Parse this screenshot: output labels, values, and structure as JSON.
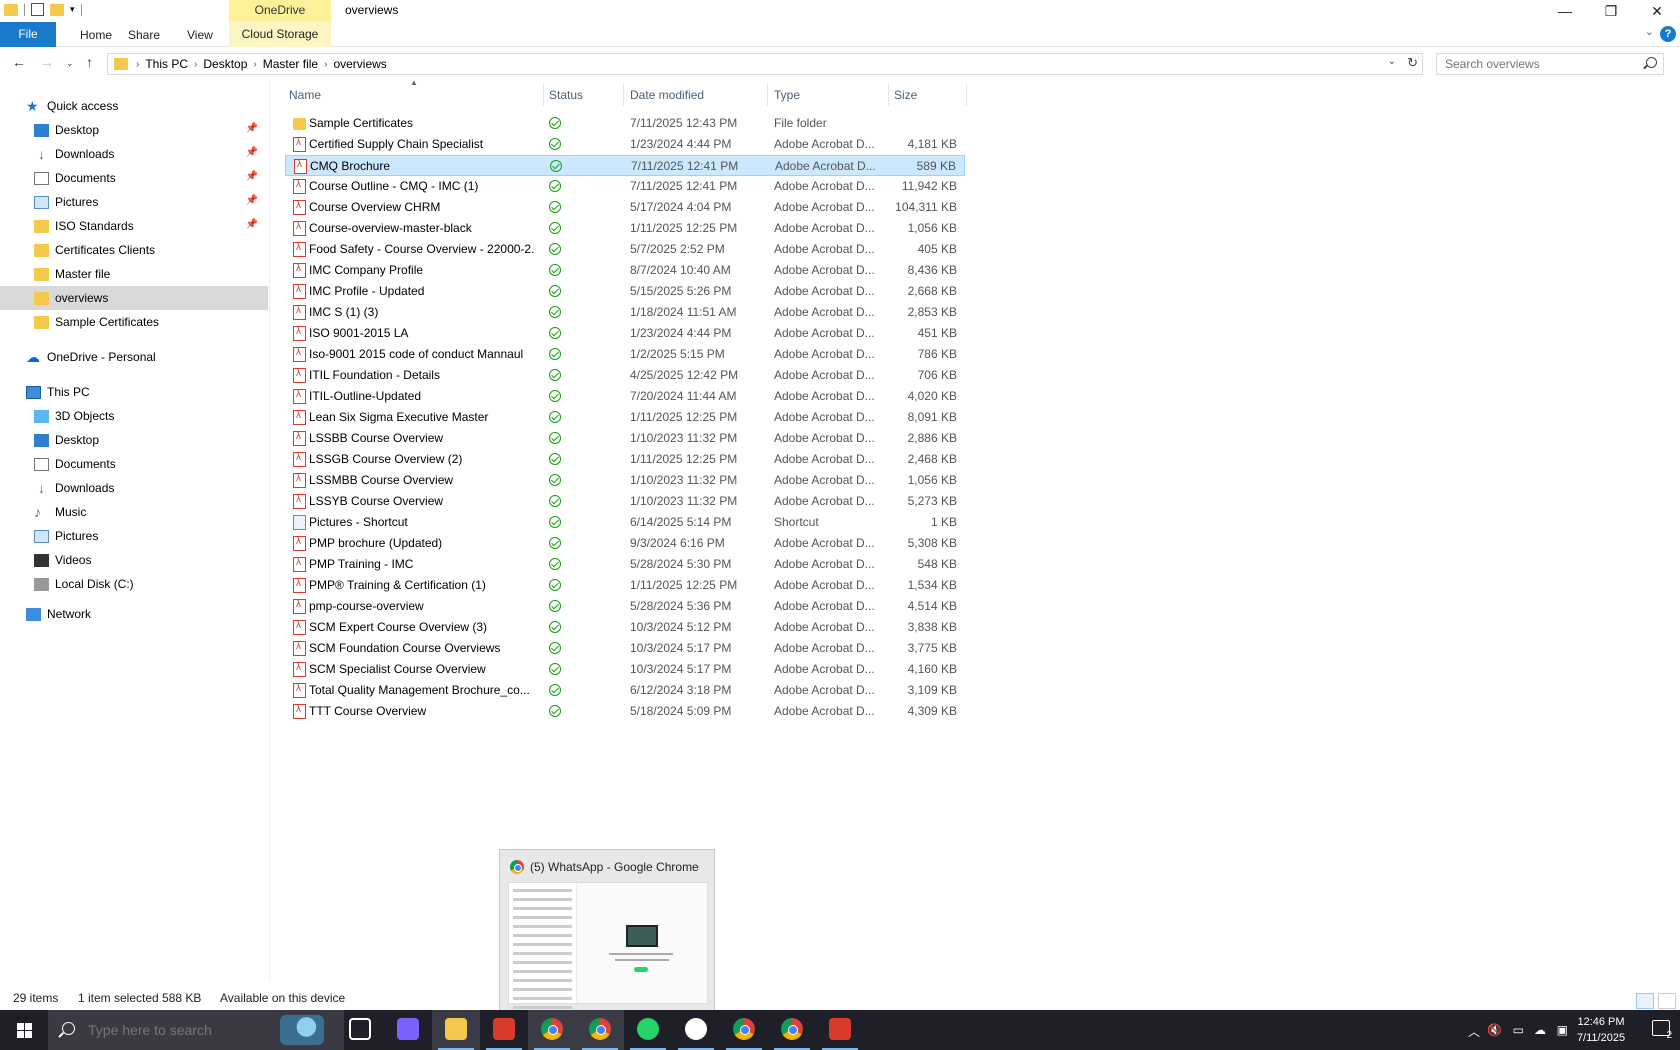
{
  "window": {
    "title": "overviews",
    "context_tab": "OneDrive",
    "controls": [
      "—",
      "❐",
      "✕"
    ]
  },
  "ribbon": {
    "file": "File",
    "home": "Home",
    "share": "Share",
    "view": "View",
    "cloud_storage": "Cloud Storage",
    "help": "?"
  },
  "address": {
    "crumbs": [
      "This PC",
      "Desktop",
      "Master file",
      "overviews"
    ],
    "search_placeholder": "Search overviews"
  },
  "nav": {
    "quick_access": "Quick access",
    "items": [
      {
        "label": "Desktop",
        "pinned": true
      },
      {
        "label": "Downloads",
        "pinned": true
      },
      {
        "label": "Documents",
        "pinned": true
      },
      {
        "label": "Pictures",
        "pinned": true
      },
      {
        "label": "ISO Standards",
        "pinned": true
      },
      {
        "label": "Certificates Clients",
        "pinned": false
      },
      {
        "label": "Master file",
        "pinned": false
      },
      {
        "label": "overviews",
        "pinned": false,
        "selected": true
      },
      {
        "label": "Sample Certificates",
        "pinned": false
      }
    ],
    "onedrive": "OneDrive - Personal",
    "this_pc": "This PC",
    "pc_items": [
      "3D Objects",
      "Desktop",
      "Documents",
      "Downloads",
      "Music",
      "Pictures",
      "Videos",
      "Local Disk (C:)"
    ],
    "network": "Network"
  },
  "columns": {
    "name": "Name",
    "status": "Status",
    "date": "Date modified",
    "type": "Type",
    "size": "Size"
  },
  "files": [
    {
      "name": "Sample Certificates",
      "date": "7/11/2025 12:43 PM",
      "type": "File folder",
      "size": "",
      "kind": "folder"
    },
    {
      "name": "Certified Supply Chain Specialist",
      "date": "1/23/2024 4:44 PM",
      "type": "Adobe Acrobat D...",
      "size": "4,181 KB",
      "kind": "pdf"
    },
    {
      "name": "CMQ Brochure",
      "date": "7/11/2025 12:41 PM",
      "type": "Adobe Acrobat D...",
      "size": "589 KB",
      "kind": "pdf",
      "selected": true
    },
    {
      "name": "Course Outline - CMQ - IMC (1)",
      "date": "7/11/2025 12:41 PM",
      "type": "Adobe Acrobat D...",
      "size": "11,942 KB",
      "kind": "pdf"
    },
    {
      "name": "Course Overview CHRM",
      "date": "5/17/2024 4:04 PM",
      "type": "Adobe Acrobat D...",
      "size": "104,311 KB",
      "kind": "pdf"
    },
    {
      "name": "Course-overview-master-black",
      "date": "1/11/2025 12:25 PM",
      "type": "Adobe Acrobat D...",
      "size": "1,056 KB",
      "kind": "pdf"
    },
    {
      "name": "Food Safety - Course Overview - 22000-2...",
      "date": "5/7/2025 2:52 PM",
      "type": "Adobe Acrobat D...",
      "size": "405 KB",
      "kind": "pdf"
    },
    {
      "name": "IMC Company Profile",
      "date": "8/7/2024 10:40 AM",
      "type": "Adobe Acrobat D...",
      "size": "8,436 KB",
      "kind": "pdf"
    },
    {
      "name": "IMC Profile - Updated",
      "date": "5/15/2025 5:26 PM",
      "type": "Adobe Acrobat D...",
      "size": "2,668 KB",
      "kind": "pdf"
    },
    {
      "name": "IMC S (1) (3)",
      "date": "1/18/2024 11:51 AM",
      "type": "Adobe Acrobat D...",
      "size": "2,853 KB",
      "kind": "pdf"
    },
    {
      "name": "ISO 9001-2015 LA",
      "date": "1/23/2024 4:44 PM",
      "type": "Adobe Acrobat D...",
      "size": "451 KB",
      "kind": "pdf"
    },
    {
      "name": "Iso-9001 2015 code of conduct Mannaul",
      "date": "1/2/2025 5:15 PM",
      "type": "Adobe Acrobat D...",
      "size": "786 KB",
      "kind": "pdf"
    },
    {
      "name": "ITIL Foundation - Details",
      "date": "4/25/2025 12:42 PM",
      "type": "Adobe Acrobat D...",
      "size": "706 KB",
      "kind": "pdf"
    },
    {
      "name": "ITIL-Outline-Updated",
      "date": "7/20/2024 11:44 AM",
      "type": "Adobe Acrobat D...",
      "size": "4,020 KB",
      "kind": "pdf"
    },
    {
      "name": "Lean Six Sigma Executive Master",
      "date": "1/11/2025 12:25 PM",
      "type": "Adobe Acrobat D...",
      "size": "8,091 KB",
      "kind": "pdf"
    },
    {
      "name": "LSSBB Course Overview",
      "date": "1/10/2023 11:32 PM",
      "type": "Adobe Acrobat D...",
      "size": "2,886 KB",
      "kind": "pdf"
    },
    {
      "name": "LSSGB Course Overview (2)",
      "date": "1/11/2025 12:25 PM",
      "type": "Adobe Acrobat D...",
      "size": "2,468 KB",
      "kind": "pdf"
    },
    {
      "name": "LSSMBB Course Overview",
      "date": "1/10/2023 11:32 PM",
      "type": "Adobe Acrobat D...",
      "size": "1,056 KB",
      "kind": "pdf"
    },
    {
      "name": "LSSYB Course Overview",
      "date": "1/10/2023 11:32 PM",
      "type": "Adobe Acrobat D...",
      "size": "5,273 KB",
      "kind": "pdf"
    },
    {
      "name": "Pictures - Shortcut",
      "date": "6/14/2025 5:14 PM",
      "type": "Shortcut",
      "size": "1 KB",
      "kind": "shortcut"
    },
    {
      "name": "PMP brochure (Updated)",
      "date": "9/3/2024 6:16 PM",
      "type": "Adobe Acrobat D...",
      "size": "5,308 KB",
      "kind": "pdf"
    },
    {
      "name": "PMP Training - IMC",
      "date": "5/28/2024 5:30 PM",
      "type": "Adobe Acrobat D...",
      "size": "548 KB",
      "kind": "pdf"
    },
    {
      "name": "PMP® Training & Certification (1)",
      "date": "1/11/2025 12:25 PM",
      "type": "Adobe Acrobat D...",
      "size": "1,534 KB",
      "kind": "pdf"
    },
    {
      "name": "pmp-course-overview",
      "date": "5/28/2024 5:36 PM",
      "type": "Adobe Acrobat D...",
      "size": "4,514 KB",
      "kind": "pdf"
    },
    {
      "name": "SCM Expert Course Overview (3)",
      "date": "10/3/2024 5:12 PM",
      "type": "Adobe Acrobat D...",
      "size": "3,838 KB",
      "kind": "pdf"
    },
    {
      "name": "SCM Foundation Course Overviews",
      "date": "10/3/2024 5:17 PM",
      "type": "Adobe Acrobat D...",
      "size": "3,775 KB",
      "kind": "pdf"
    },
    {
      "name": "SCM Specialist Course Overview",
      "date": "10/3/2024 5:17 PM",
      "type": "Adobe Acrobat D...",
      "size": "4,160 KB",
      "kind": "pdf"
    },
    {
      "name": "Total Quality Management Brochure_co...",
      "date": "6/12/2024 3:18 PM",
      "type": "Adobe Acrobat D...",
      "size": "3,109 KB",
      "kind": "pdf"
    },
    {
      "name": "TTT Course Overview",
      "date": "5/18/2024 5:09 PM",
      "type": "Adobe Acrobat D...",
      "size": "4,309 KB",
      "kind": "pdf"
    }
  ],
  "status": {
    "count": "29 items",
    "selected": "1 item selected  588 KB",
    "availability": "Available on this device"
  },
  "thumbnail": {
    "title": "(5) WhatsApp - Google Chrome"
  },
  "taskbar": {
    "search_placeholder": "Type here to search",
    "time": "12:46 PM",
    "date": "7/11/2025",
    "notification_count": "2",
    "apps": [
      {
        "name": "task-view",
        "color": "#ffffff"
      },
      {
        "name": "copilot",
        "color": "#7b61ff"
      },
      {
        "name": "file-explorer",
        "color": "#f2c94c"
      },
      {
        "name": "app-red-blue",
        "color": "#d83b2e"
      },
      {
        "name": "chrome",
        "color": "#4285f4"
      },
      {
        "name": "chrome",
        "color": "#4285f4"
      },
      {
        "name": "whatsapp",
        "color": "#25d366"
      },
      {
        "name": "clock-app",
        "color": "#ffffff"
      },
      {
        "name": "chrome",
        "color": "#4285f4"
      },
      {
        "name": "chrome",
        "color": "#4285f4"
      },
      {
        "name": "acrobat",
        "color": "#d83b2e"
      }
    ]
  }
}
